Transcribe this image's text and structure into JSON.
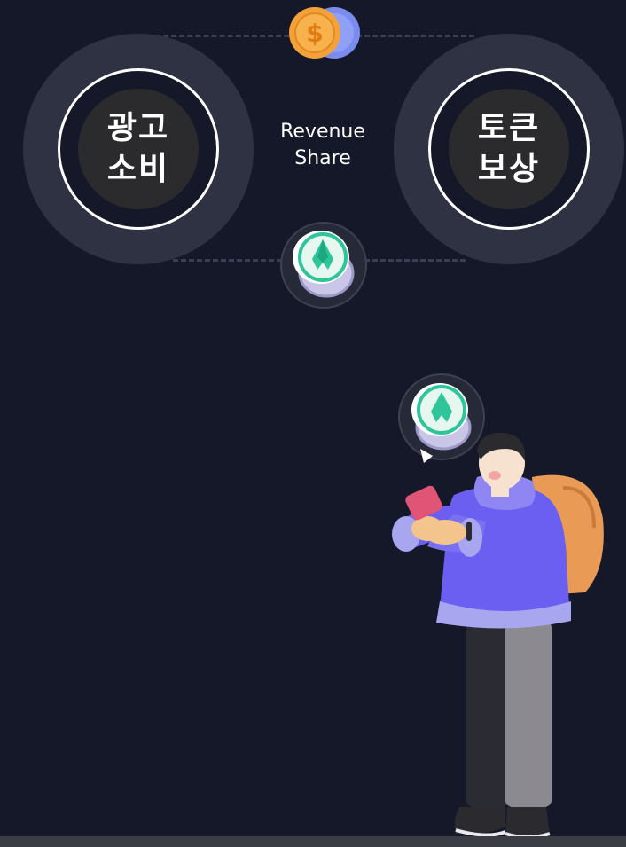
{
  "left_circle": {
    "label": "광고\n소비"
  },
  "right_circle": {
    "label": "토큰\n보상"
  },
  "center_text": {
    "line1": "Revenue",
    "line2": "Share"
  },
  "icons": {
    "top_coin": "dollar-coin-icon",
    "middle_token": "green-crystal-token-icon",
    "bubble_token": "green-crystal-token-icon"
  },
  "colors": {
    "background": "#151828",
    "ring": "#2f3242",
    "inner": "#2b2b2d",
    "coin_gold": "#f4a13a",
    "coin_blue": "#7b8cf0",
    "token_green": "#2fc59a",
    "hoodie": "#6a5ff0",
    "backpack": "#e99a55"
  }
}
